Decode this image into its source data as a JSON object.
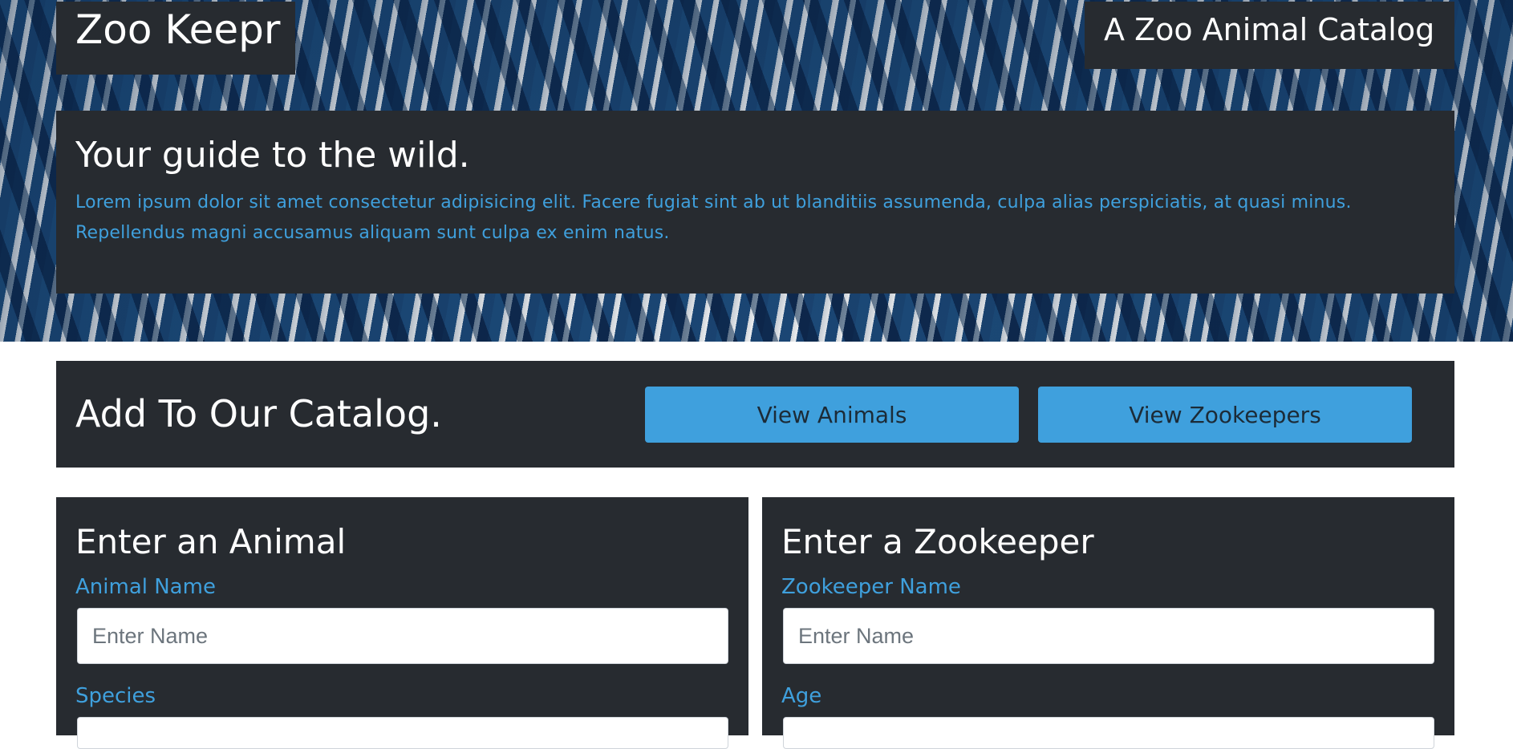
{
  "header": {
    "brand": "Zoo Keepr",
    "tagline": "A Zoo Animal Catalog"
  },
  "hero": {
    "heading": "Your guide to the wild.",
    "body": "Lorem ipsum dolor sit amet consectetur adipisicing elit. Facere fugiat sint ab ut blanditiis assumenda, culpa alias perspiciatis, at quasi minus. Repellendus magni accusamus aliquam sunt culpa ex enim natus."
  },
  "catalog": {
    "heading": "Add To Our Catalog.",
    "view_animals_label": "View Animals",
    "view_zookeepers_label": "View Zookeepers"
  },
  "animal_form": {
    "title": "Enter an Animal",
    "name_label": "Animal Name",
    "name_placeholder": "Enter Name",
    "name_value": "",
    "species_label": "Species",
    "species_value": ""
  },
  "zookeeper_form": {
    "title": "Enter a Zookeeper",
    "name_label": "Zookeeper Name",
    "name_placeholder": "Enter Name",
    "name_value": "",
    "age_label": "Age",
    "age_value": ""
  },
  "colors": {
    "panel_bg": "#272b30",
    "accent": "#3fa0dd",
    "zebra_blue": "#1c4a78"
  }
}
